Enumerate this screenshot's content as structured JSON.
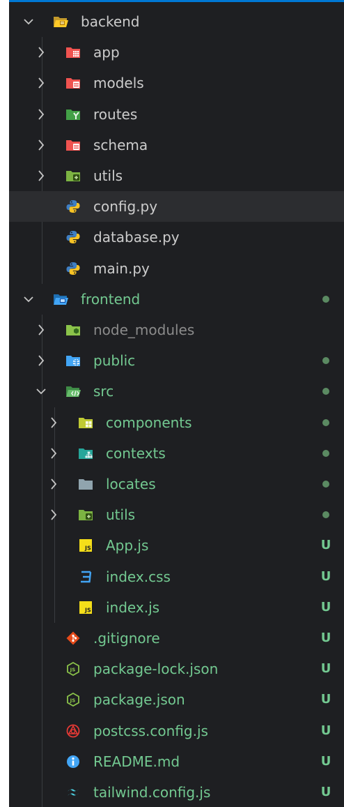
{
  "theme": {
    "background": "#1e1f22",
    "selected_row": "#2c2d30",
    "text_default": "#cccccc",
    "text_untracked": "#73c991",
    "text_ignored": "#8b8b8b",
    "dot_color": "#5b8a62",
    "accent": "#0078d4"
  },
  "explorer": {
    "items": [
      {
        "label": "backend",
        "icon": "folder-open-backend-icon",
        "expanded": true,
        "chevron": "open"
      },
      {
        "label": "app",
        "icon": "folder-app-icon",
        "chevron": "closed"
      },
      {
        "label": "models",
        "icon": "folder-models-icon",
        "chevron": "closed"
      },
      {
        "label": "routes",
        "icon": "folder-routes-icon",
        "chevron": "closed"
      },
      {
        "label": "schema",
        "icon": "folder-schema-icon",
        "chevron": "closed"
      },
      {
        "label": "utils",
        "icon": "folder-utils-icon",
        "chevron": "closed"
      },
      {
        "label": "config.py",
        "icon": "python-file-icon",
        "selected": true
      },
      {
        "label": "database.py",
        "icon": "python-file-icon"
      },
      {
        "label": "main.py",
        "icon": "python-file-icon"
      },
      {
        "label": "frontend",
        "icon": "folder-open-frontend-icon",
        "chevron": "open",
        "dot": true
      },
      {
        "label": "node_modules",
        "icon": "folder-node-icon",
        "chevron": "closed",
        "ignored": true
      },
      {
        "label": "public",
        "icon": "folder-public-icon",
        "chevron": "closed",
        "dot": true
      },
      {
        "label": "src",
        "icon": "folder-open-src-icon",
        "chevron": "open",
        "dot": true
      },
      {
        "label": "components",
        "icon": "folder-components-icon",
        "chevron": "closed",
        "dot": true
      },
      {
        "label": "contexts",
        "icon": "folder-contexts-icon",
        "chevron": "closed",
        "dot": true
      },
      {
        "label": "locates",
        "icon": "folder-plain-icon",
        "chevron": "closed",
        "dot": true
      },
      {
        "label": "utils",
        "icon": "folder-utils-icon",
        "chevron": "closed",
        "dot": true
      },
      {
        "label": "App.js",
        "icon": "js-file-icon",
        "status": "U"
      },
      {
        "label": "index.css",
        "icon": "css-file-icon",
        "status": "U"
      },
      {
        "label": "index.js",
        "icon": "js-file-icon",
        "status": "U"
      },
      {
        "label": ".gitignore",
        "icon": "git-file-icon",
        "status": "U"
      },
      {
        "label": "package-lock.json",
        "icon": "nodejs-file-icon",
        "status": "U"
      },
      {
        "label": "package.json",
        "icon": "nodejs-file-icon",
        "status": "U"
      },
      {
        "label": "postcss.config.js",
        "icon": "postcss-file-icon",
        "status": "U"
      },
      {
        "label": "README.md",
        "icon": "info-file-icon",
        "status": "U"
      },
      {
        "label": "tailwind.config.js",
        "icon": "tailwind-file-icon",
        "status": "U"
      }
    ]
  }
}
